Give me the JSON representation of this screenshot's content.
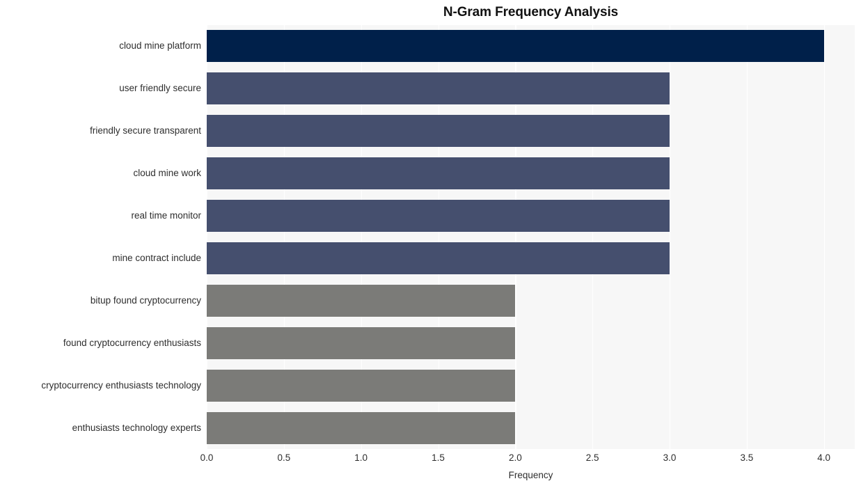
{
  "chart_data": {
    "type": "bar",
    "orientation": "horizontal",
    "title": "N-Gram Frequency Analysis",
    "xlabel": "Frequency",
    "ylabel": "",
    "xlim": [
      0.0,
      4.2
    ],
    "xticks": [
      "0.0",
      "0.5",
      "1.0",
      "1.5",
      "2.0",
      "2.5",
      "3.0",
      "3.5",
      "4.0"
    ],
    "xtick_values": [
      0.0,
      0.5,
      1.0,
      1.5,
      2.0,
      2.5,
      3.0,
      3.5,
      4.0
    ],
    "grid": "vertical-white-on-light-gray",
    "legend": "none",
    "categories": [
      "cloud mine platform",
      "user friendly secure",
      "friendly secure transparent",
      "cloud mine work",
      "real time monitor",
      "mine contract include",
      "bitup found cryptocurrency",
      "found cryptocurrency enthusiasts",
      "cryptocurrency enthusiasts technology",
      "enthusiasts technology experts"
    ],
    "values": [
      4,
      3,
      3,
      3,
      3,
      3,
      2,
      2,
      2,
      2
    ],
    "bar_colors": [
      "#00204a",
      "#454f6e",
      "#454f6e",
      "#454f6e",
      "#454f6e",
      "#454f6e",
      "#7b7b78",
      "#7b7b78",
      "#7b7b78",
      "#7b7b78"
    ]
  },
  "style": {
    "plot_background": "#f7f7f7",
    "figure_background": "#ffffff",
    "gridline_color": "#ffffff",
    "text_color": "#2e2e2e",
    "title_color": "#111111"
  }
}
